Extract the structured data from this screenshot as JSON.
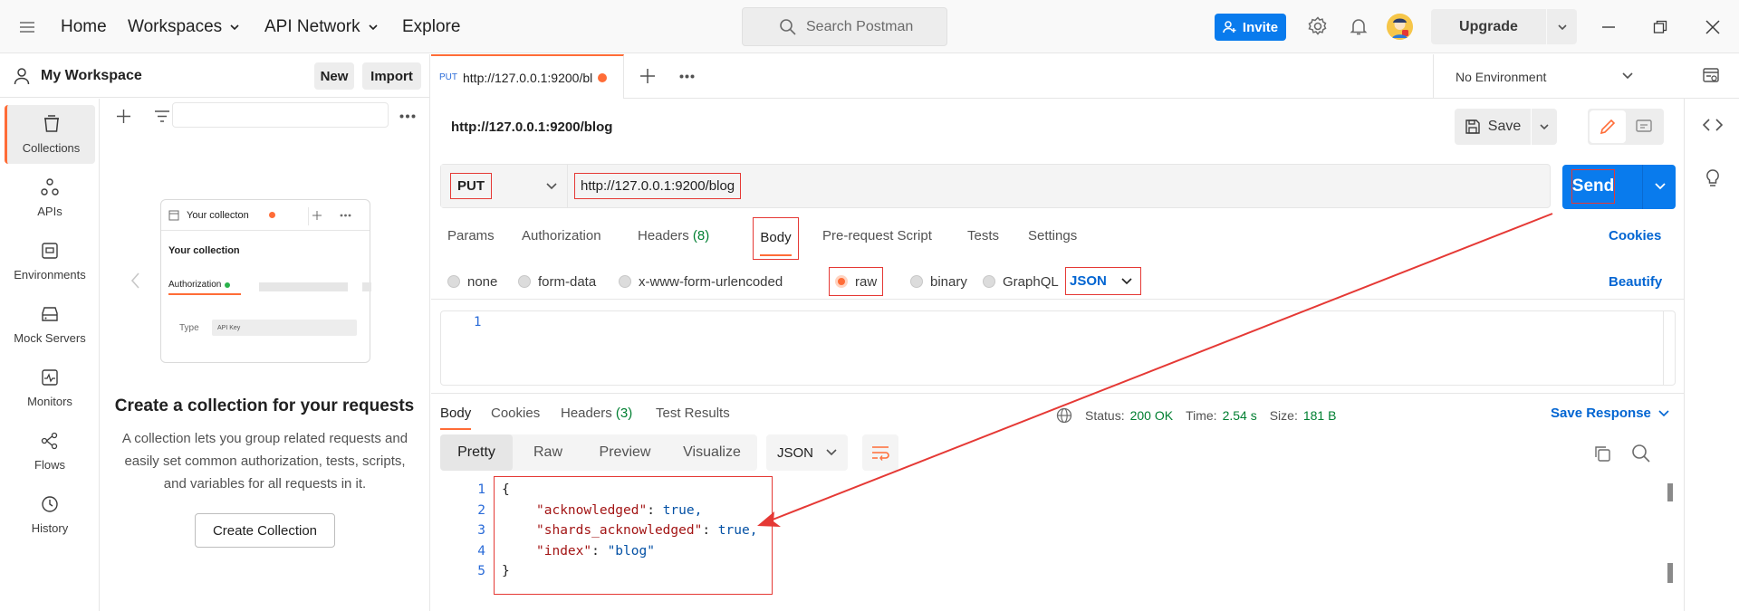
{
  "topbar": {
    "home": "Home",
    "workspaces": "Workspaces",
    "api_network": "API Network",
    "explore": "Explore",
    "search_placeholder": "Search Postman",
    "invite": "Invite",
    "upgrade": "Upgrade"
  },
  "workspace": {
    "title": "My Workspace",
    "new_label": "New",
    "import_label": "Import"
  },
  "sidebar": {
    "items": [
      {
        "label": "Collections",
        "icon": "collections-icon"
      },
      {
        "label": "APIs",
        "icon": "apis-icon"
      },
      {
        "label": "Environments",
        "icon": "environments-icon"
      },
      {
        "label": "Mock Servers",
        "icon": "mock-servers-icon"
      },
      {
        "label": "Monitors",
        "icon": "monitors-icon"
      },
      {
        "label": "Flows",
        "icon": "flows-icon"
      },
      {
        "label": "History",
        "icon": "history-icon"
      }
    ]
  },
  "empty_state": {
    "card_tab": "Your collecton",
    "card_title": "Your collection",
    "card_auth": "Authorization",
    "card_type": "Type",
    "card_type_value": "API Key",
    "title": "Create a collection for your requests",
    "description": "A collection lets you group related requests and easily set common authorization, tests, scripts, and variables for all requests in it.",
    "create_button": "Create Collection"
  },
  "request_tab": {
    "method": "PUT",
    "url": "http://127.0.0.1:9200/bl"
  },
  "environment": "No Environment",
  "request": {
    "title": "http://127.0.0.1:9200/blog",
    "save": "Save",
    "method": "PUT",
    "url": "http://127.0.0.1:9200/blog",
    "send": "Send",
    "tabs": [
      "Params",
      "Authorization",
      "Headers",
      "Body",
      "Pre-request Script",
      "Tests",
      "Settings"
    ],
    "headers_count": "(8)",
    "cookies": "Cookies",
    "body_options": [
      "none",
      "form-data",
      "x-www-form-urlencoded",
      "raw",
      "binary",
      "GraphQL"
    ],
    "body_format": "JSON",
    "beautify": "Beautify",
    "editor_line": "1"
  },
  "response": {
    "tabs": [
      "Body",
      "Cookies",
      "Headers",
      "Test Results"
    ],
    "headers_count": "(3)",
    "status_label": "Status:",
    "status_value": "200 OK",
    "time_label": "Time:",
    "time_value": "2.54 s",
    "size_label": "Size:",
    "size_value": "181 B",
    "save_response": "Save Response",
    "views": [
      "Pretty",
      "Raw",
      "Preview",
      "Visualize"
    ],
    "format": "JSON",
    "lines": [
      {
        "n": "1",
        "text": "{"
      },
      {
        "n": "2",
        "key": "\"acknowledged\"",
        "value": "true,"
      },
      {
        "n": "3",
        "key": "\"shards_acknowledged\"",
        "value": "true,"
      },
      {
        "n": "4",
        "key": "\"index\"",
        "value": "\"blog\""
      },
      {
        "n": "5",
        "text": "}"
      }
    ]
  },
  "colors": {
    "accent": "#ff6c37",
    "primary": "#097bed",
    "annotation": "#e53935",
    "success": "#007f31"
  }
}
